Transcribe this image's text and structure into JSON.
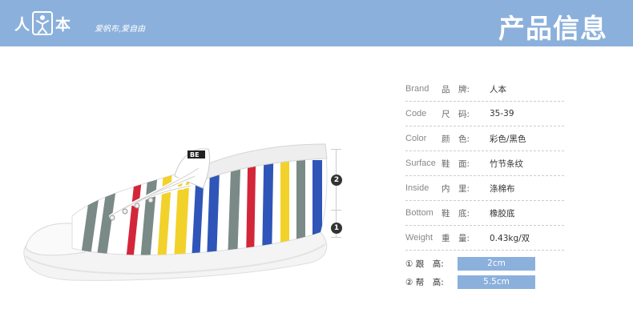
{
  "header": {
    "logo_left": "人",
    "logo_right": "本",
    "slogan": "爱帆布,爱自由",
    "title": "产品信息",
    "bg_color": "#8bb0dc"
  },
  "markers": {
    "upper": "2",
    "lower": "1"
  },
  "specs": [
    {
      "en": "Brand",
      "cn": "品　牌:",
      "value": "人本"
    },
    {
      "en": "Code",
      "cn": "尺　码:",
      "value": "35-39"
    },
    {
      "en": "Color",
      "cn": "颜　色:",
      "value": "彩色/黑色"
    },
    {
      "en": "Surface",
      "cn": "鞋　面:",
      "value": "竹节条纹"
    },
    {
      "en": "Inside",
      "cn": "内　里:",
      "value": "涤棉布"
    },
    {
      "en": "Bottom",
      "cn": "鞋　底:",
      "value": "橡胶底"
    },
    {
      "en": "Weight",
      "cn": "重　量:",
      "value": "0.43kg/双"
    }
  ],
  "heights": [
    {
      "label": "① 跟　高:",
      "value": "2cm"
    },
    {
      "label": "② 帮　高:",
      "value": "5.5cm"
    }
  ],
  "shoe_tongue_text": "BE"
}
